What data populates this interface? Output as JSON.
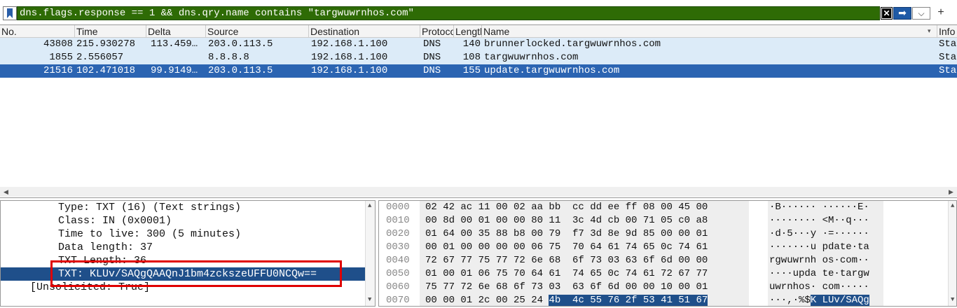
{
  "filter": {
    "value": "dns.flags.response == 1 && dns.qry.name contains \"targwuwrnhos.com\"",
    "clear_icon": "✕",
    "apply_icon": "➡",
    "dropdown_icon": "⌵",
    "add_icon": "+"
  },
  "packet_list": {
    "columns": [
      "No.",
      "Time",
      "Delta",
      "Source",
      "Destination",
      "Protocol",
      "Length",
      "Name",
      "Info"
    ],
    "rows": [
      {
        "no": "43808",
        "time": "215.930278",
        "delta": "113.459…",
        "source": "203.0.113.5",
        "destination": "192.168.1.100",
        "protocol": "DNS",
        "length": "140",
        "name": "brunnerlocked.targwuwrnhos.com",
        "info": "Sta"
      },
      {
        "no": "1855",
        "time": "2.556057",
        "delta": "",
        "source": "8.8.8.8",
        "destination": "192.168.1.100",
        "protocol": "DNS",
        "length": "108",
        "name": "targwuwrnhos.com",
        "info": "Sta"
      },
      {
        "no": "21516",
        "time": "102.471018",
        "delta": "99.9149…",
        "source": "203.0.113.5",
        "destination": "192.168.1.100",
        "protocol": "DNS",
        "length": "155",
        "name": "update.targwuwrnhos.com",
        "info": "Sta"
      }
    ],
    "selected_index": 2
  },
  "details": [
    "Type: TXT (16) (Text strings)",
    "Class: IN (0x0001)",
    "Time to live: 300 (5 minutes)",
    "Data length: 37",
    "TXT Length: 36",
    "TXT: KLUv/SAQgQAAQnJ1bm4zckszeUFFU0NCQw==",
    "[Unsolicited: True]"
  ],
  "hex": [
    {
      "offset": "0000",
      "bytes": "02 42 ac 11 00 02 aa bb  cc dd ee ff 08 00 45 00",
      "ascii": "·B······ ······E·"
    },
    {
      "offset": "0010",
      "bytes": "00 8d 00 01 00 00 80 11  3c 4d cb 00 71 05 c0 a8",
      "ascii": "········ <M··q···"
    },
    {
      "offset": "0020",
      "bytes": "01 64 00 35 88 b8 00 79  f7 3d 8e 9d 85 00 00 01",
      "ascii": "·d·5···y ·=······"
    },
    {
      "offset": "0030",
      "bytes": "00 01 00 00 00 00 06 75  70 64 61 74 65 0c 74 61",
      "ascii": "·······u pdate·ta"
    },
    {
      "offset": "0040",
      "bytes": "72 67 77 75 77 72 6e 68  6f 73 03 63 6f 6d 00 00",
      "ascii": "rgwuwrnh os·com··"
    },
    {
      "offset": "0050",
      "bytes": "01 00 01 06 75 70 64 61  74 65 0c 74 61 72 67 77",
      "ascii": "····upda te·targw"
    },
    {
      "offset": "0060",
      "bytes": "75 77 72 6e 68 6f 73 03  63 6f 6d 00 00 10 00 01",
      "ascii": "uwrnhos· com·····"
    },
    {
      "offset": "0070",
      "bytes_plain": "00 00 01 2c 00 25 24 ",
      "bytes_hl": "4b  4c 55 76 2f 53 41 51 67",
      "ascii_plain": "···,·%$",
      "ascii_hl": "K LUv/SAQg"
    }
  ],
  "colors": {
    "filter_bg": "#2e6b05",
    "selected_row": "#2b64b2",
    "row_highlight": "#dcebf8",
    "detail_selected": "#1f4f8a",
    "highlight_box": "#e00000"
  }
}
